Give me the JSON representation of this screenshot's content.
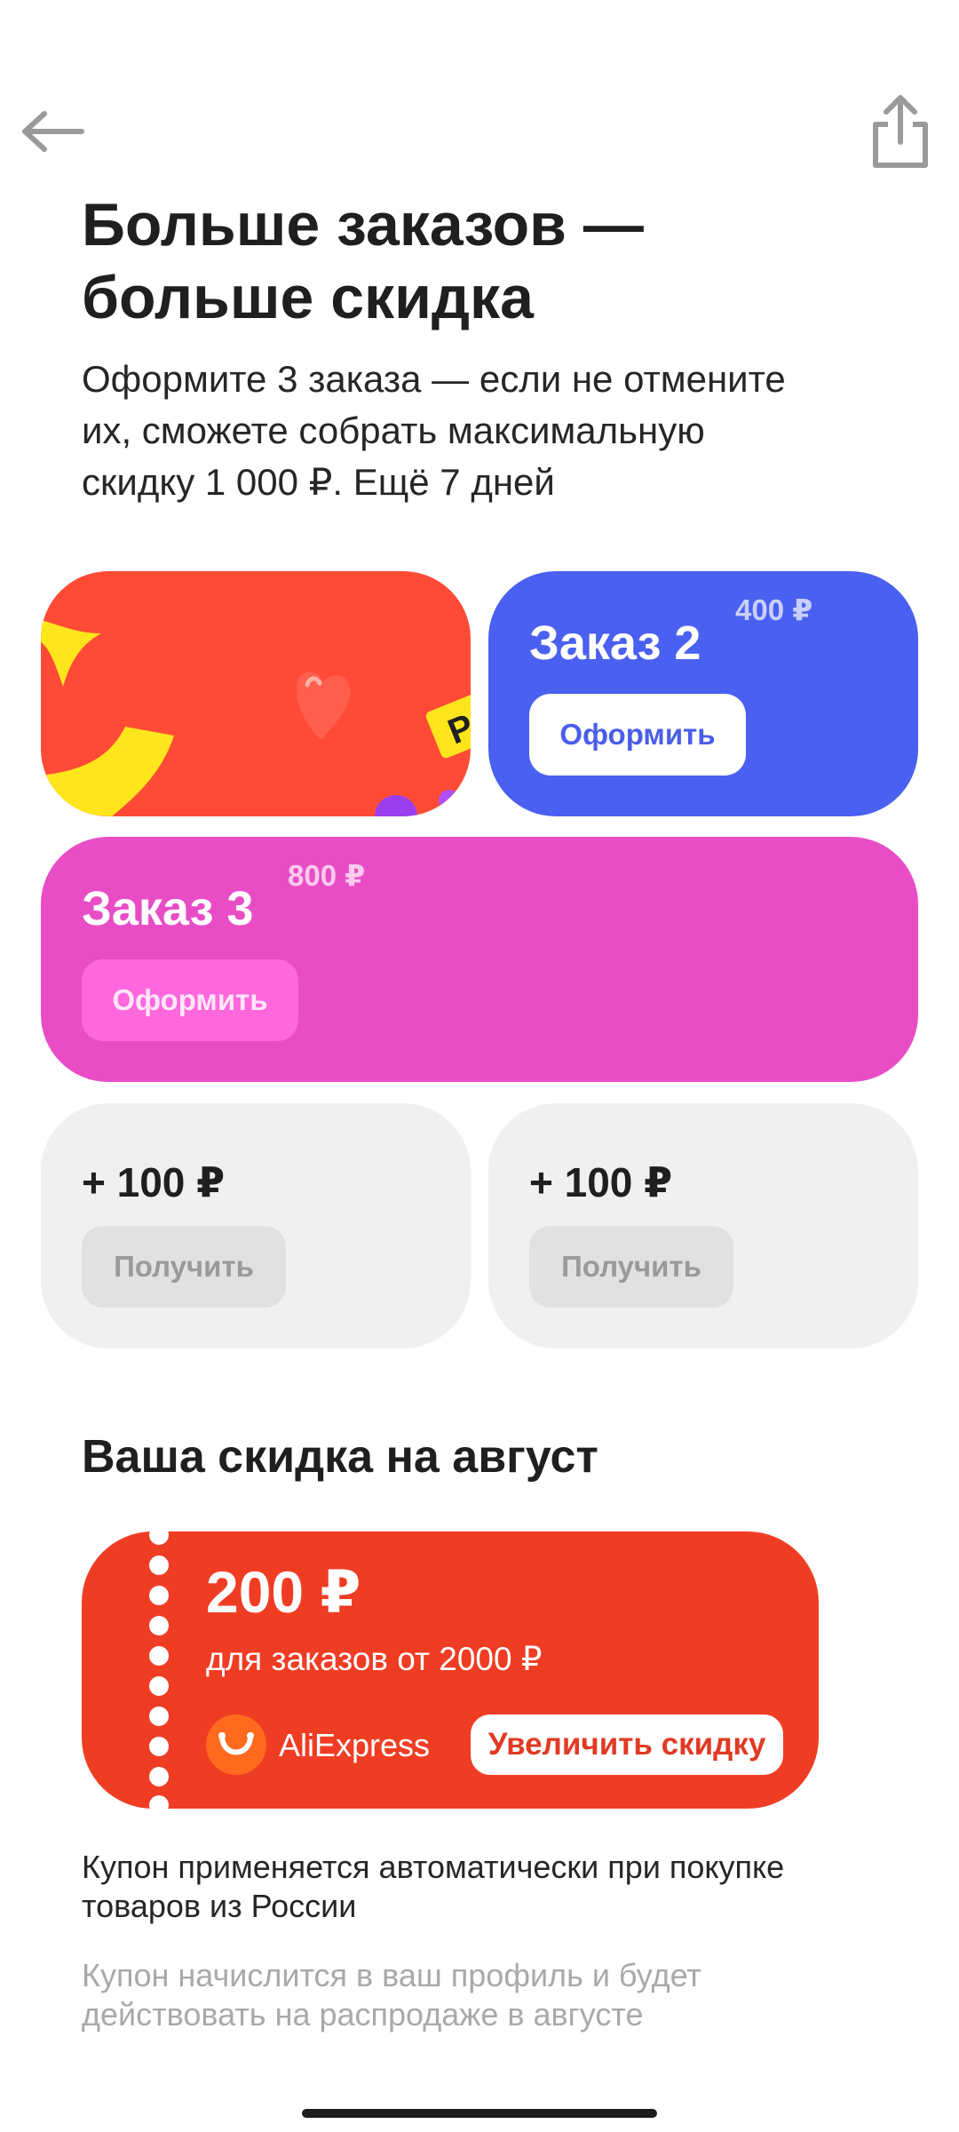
{
  "header": {
    "back_icon": "arrow-left-icon",
    "share_icon": "share-icon"
  },
  "promo": {
    "title": "Больше заказов —\nбольше скидка",
    "subtitle": "Оформите 3 заказа — если не отмените\nих, сможете собрать максимальную\nскидку 1 000 ₽. Ещё 7 дней"
  },
  "orders": [
    {
      "title": "Заказ 2",
      "amount": "400 ₽",
      "button": "Оформить"
    },
    {
      "title": "Заказ 3",
      "amount": "800 ₽",
      "button": "Оформить"
    }
  ],
  "bonuses": [
    {
      "value": "+ 100 ₽",
      "button": "Получить"
    },
    {
      "value": "+ 100 ₽",
      "button": "Получить"
    }
  ],
  "section": {
    "title": "Ваша скидка на август"
  },
  "coupon": {
    "amount": "200 ₽",
    "condition": "для заказов от 2000 ₽",
    "brand": "AliExpress",
    "button": "Увеличить скидку"
  },
  "notes": {
    "auto": "Купон применяется автоматически при покупке\nтоваров из России",
    "accrual": "Купон начислится в ваш профиль и будет\nдействовать на распродаже в августе"
  },
  "colors": {
    "promo_card": "#ff4b36",
    "order2_card": "#4a60f0",
    "order3_card": "#e94dc6",
    "bonus_card": "#f0f0f0",
    "coupon": "#ef3d24"
  }
}
